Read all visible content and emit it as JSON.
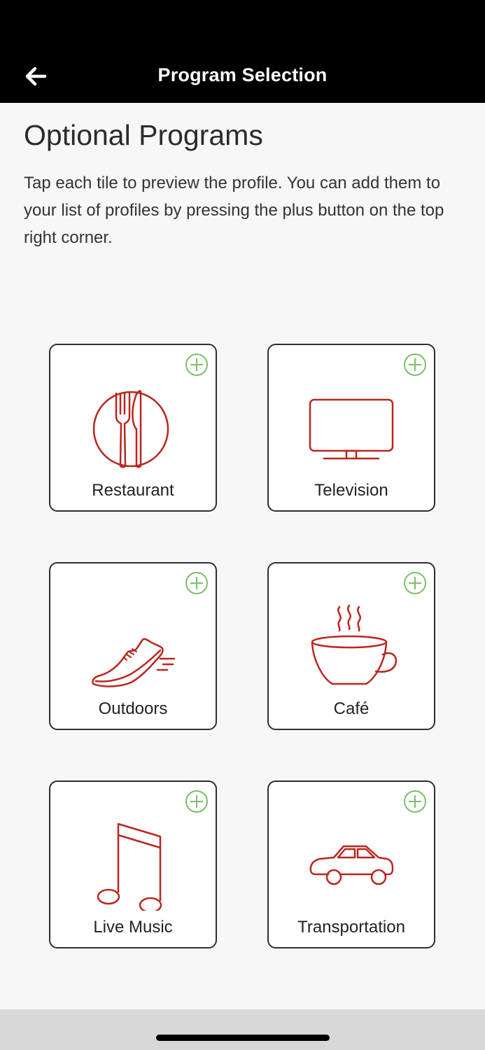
{
  "header": {
    "title": "Program Selection",
    "back_icon": "arrow-left-icon"
  },
  "main": {
    "heading": "Optional Programs",
    "description": "Tap each tile to preview the profile. You can add them to your list of profiles by pressing the plus button on the top right corner."
  },
  "colors": {
    "icon_red": "#b9261f",
    "add_green": "#7cbf6a",
    "header_bg": "#000000",
    "page_bg": "#f7f7f7"
  },
  "tiles": [
    {
      "label": "Restaurant",
      "icon": "plate-fork-knife-icon"
    },
    {
      "label": "Television",
      "icon": "television-icon"
    },
    {
      "label": "Outdoors",
      "icon": "running-shoe-icon"
    },
    {
      "label": "Café",
      "icon": "coffee-cup-icon"
    },
    {
      "label": "Live Music",
      "icon": "music-note-icon"
    },
    {
      "label": "Transportation",
      "icon": "car-icon"
    }
  ]
}
